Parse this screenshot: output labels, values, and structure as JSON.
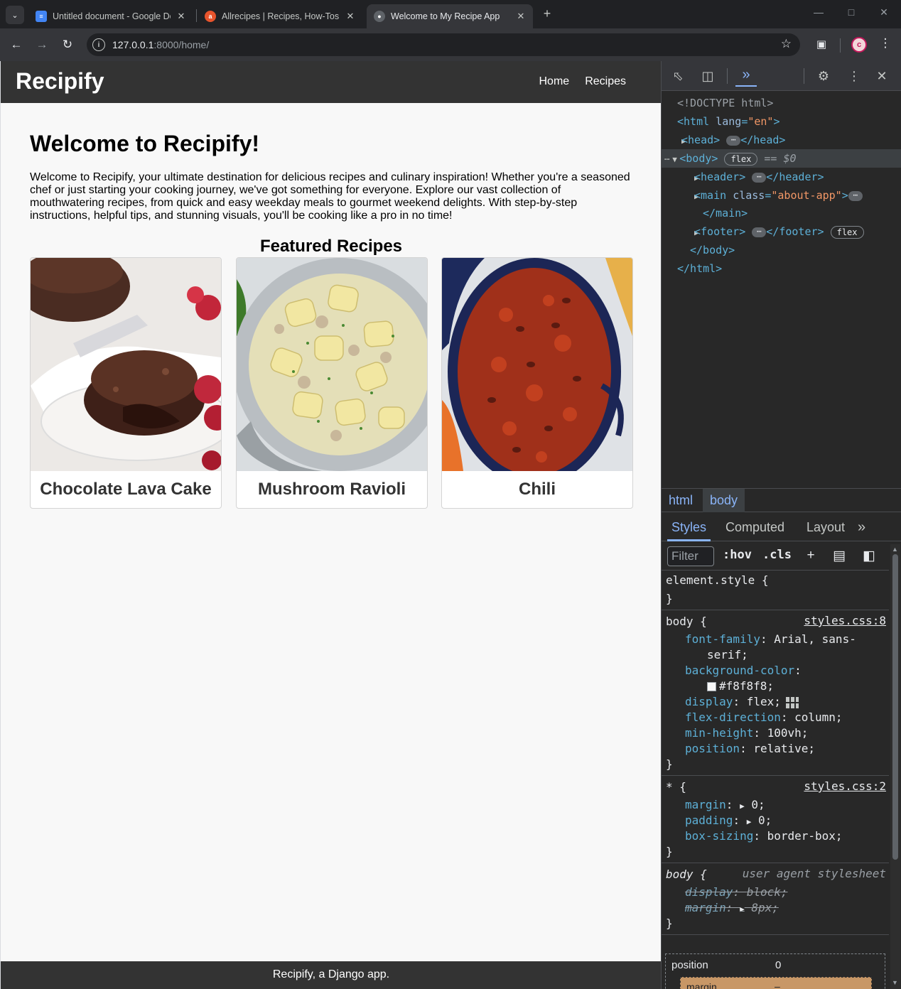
{
  "browser": {
    "tabs": [
      {
        "title": "Untitled document - Google Do",
        "favicon": "docs-icon",
        "active": false
      },
      {
        "title": "Allrecipes | Recipes, How-Tos, V",
        "favicon": "allrecipes-icon",
        "active": false
      },
      {
        "title": "Welcome to My Recipe App",
        "favicon": "globe-icon",
        "active": true
      }
    ],
    "url_host": "127.0.0.1",
    "url_path": ":8000/home/",
    "profile_initial": "c"
  },
  "site": {
    "brand": "Recipify",
    "nav": [
      "Home",
      "Recipes"
    ],
    "heading": "Welcome to Recipify!",
    "intro": "Welcome to Recipify, your ultimate destination for delicious recipes and culinary inspiration! Whether you're a seasoned chef or just starting your cooking journey, we've got something for everyone. Explore our vast collection of mouthwatering recipes, from quick and easy weekday meals to gourmet weekend delights. With step-by-step instructions, helpful tips, and stunning visuals, you'll be cooking like a pro in no time!",
    "featured_heading": "Featured Recipes",
    "recipes": [
      {
        "title": "Chocolate Lava Cake"
      },
      {
        "title": "Mushroom Ravioli"
      },
      {
        "title": "Chili"
      }
    ],
    "footer": "Recipify, a Django app."
  },
  "devtools": {
    "elements": {
      "doctype": "<!DOCTYPE html>",
      "html_open_tag": "<html",
      "html_lang_attr": "lang",
      "html_lang_val": "\"en\"",
      "head_open": "<head>",
      "head_close": "</head>",
      "body_open": "<body>",
      "body_pill": "flex",
      "body_eq": "== $0",
      "header_open": "<header>",
      "header_close": "</header>",
      "main_open": "<main",
      "main_attr": "class",
      "main_val": "\"about-app\"",
      "main_close": "</main>",
      "footer_open": "<footer>",
      "footer_close": "</footer>",
      "footer_pill": "flex",
      "body_close": "</body>",
      "html_close": "</html>"
    },
    "breadcrumbs": [
      "html",
      "body"
    ],
    "style_tabs": [
      "Styles",
      "Computed",
      "Layout"
    ],
    "filter_placeholder": "Filter",
    "hov": ":hov",
    "cls": ".cls",
    "rules": {
      "element_style_selector": "element.style {",
      "close_brace": "}",
      "body_selector": "body {",
      "body_source": "styles.css:8",
      "font_family_prop": "font-family",
      "font_family_val_1": "Arial, sans-",
      "font_family_val_2": "serif;",
      "bg_prop": "background-color",
      "bg_val": "#f8f8f8;",
      "display_prop": "display",
      "display_val": "flex;",
      "flex_dir_prop": "flex-direction",
      "flex_dir_val": "column;",
      "min_height_prop": "min-height",
      "min_height_val": "100vh;",
      "position_prop": "position",
      "position_val": "relative;",
      "star_selector": "* {",
      "star_source": "styles.css:2",
      "margin_prop": "margin",
      "margin_val": "0;",
      "padding_prop": "padding",
      "padding_val": "0;",
      "box_sizing_prop": "box-sizing",
      "box_sizing_val": "border-box;",
      "ua_selector": "body {",
      "ua_source": "user agent stylesheet",
      "ua_display_prop": "display",
      "ua_display_val": "block;",
      "ua_margin_prop": "margin",
      "ua_margin_val": "8px;"
    },
    "box_model": {
      "position_label": "position",
      "position_value": "0",
      "margin_label": "margin",
      "margin_value": "–"
    }
  },
  "colors": {
    "site_header": "#333333",
    "page_bg": "#f8f8f8",
    "devtools_bg": "#282828",
    "accent": "#8ab4f8"
  }
}
